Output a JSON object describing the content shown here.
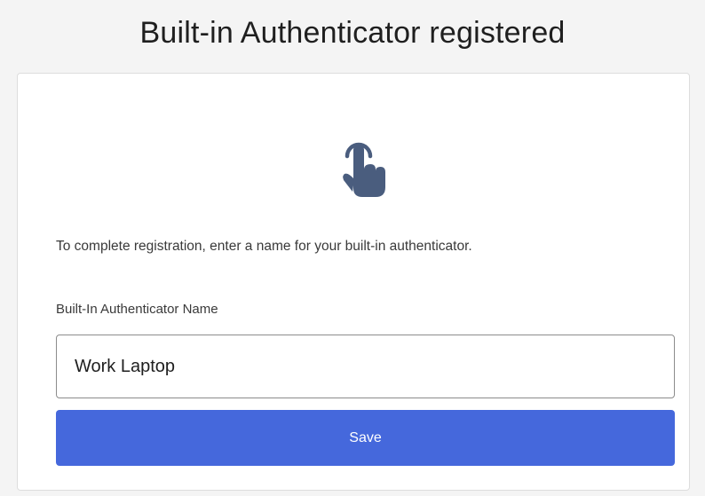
{
  "header": {
    "title": "Built-in Authenticator registered"
  },
  "card": {
    "icon": "touch-hand-icon",
    "instructions": "To complete registration, enter a name for your built-in authenticator.",
    "field_label": "Built-In Authenticator Name",
    "field_value": "Work Laptop",
    "save_label": "Save"
  },
  "colors": {
    "accent": "#4568dc",
    "icon": "#4a5d7e",
    "background": "#f4f4f4"
  }
}
